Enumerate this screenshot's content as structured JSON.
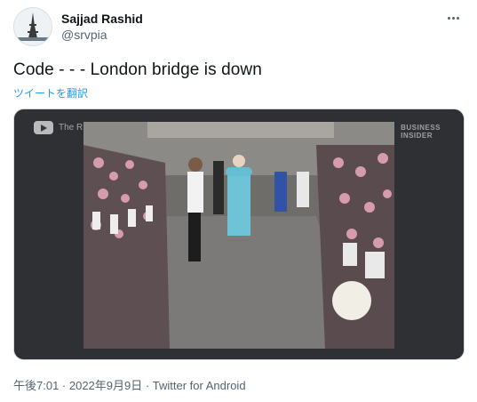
{
  "author": {
    "display_name": "Sajjad Rashid",
    "handle": "@srvpia"
  },
  "tweet": {
    "text": "Code - - - London bridge is down",
    "translate_label": "ツイートを翻訳"
  },
  "media": {
    "video_title": "The R",
    "watermark_line1": "BUSINESS",
    "watermark_line2": "INSIDER"
  },
  "meta": {
    "text": "午後7:01 · 2022年9月9日 · Twitter for Android"
  },
  "colors": {
    "link": "#1d9bf0",
    "secondary_text": "#536471",
    "primary_text": "#0f1419"
  },
  "icons": {
    "more": "more-icon",
    "play": "youtube-icon"
  }
}
